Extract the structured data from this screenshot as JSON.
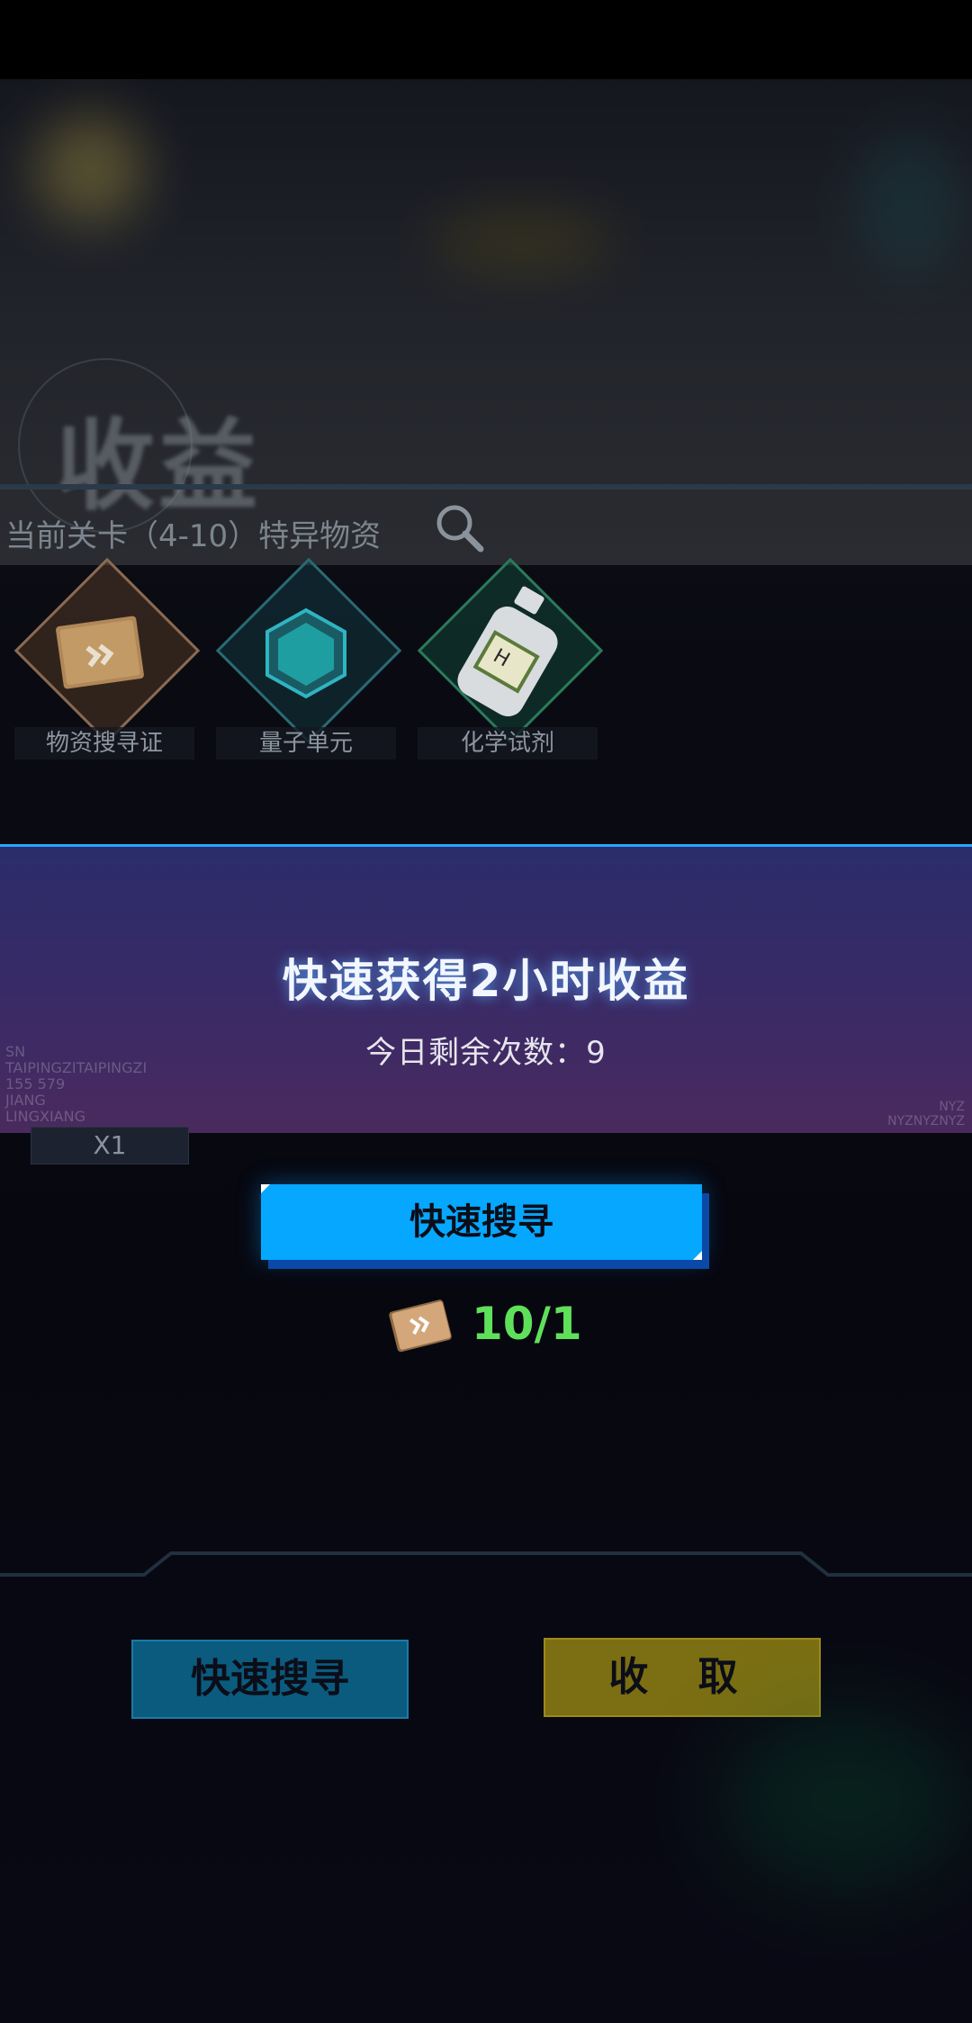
{
  "screen": {
    "title": "收益",
    "section_label": "当前关卡（4-10）特异物资"
  },
  "items": [
    {
      "label": "物资搜寻证",
      "icon": "search-permit-icon"
    },
    {
      "label": "量子单元",
      "icon": "quantum-unit-icon"
    },
    {
      "label": "化学试剂",
      "icon": "chemical-reagent-icon"
    }
  ],
  "modal": {
    "title": "快速获得2小时收益",
    "remaining": "今日剩余次数：9",
    "button_label": "快速搜寻",
    "cost_text": "10/1"
  },
  "background": {
    "faint_left": "SN\nTAIPINGZITAIPINGZI\n155 579\nJIANG\nLINGXIANG",
    "faint_right": "NYZ\nNYZNYZNYZ",
    "x1_label": "X1"
  },
  "bottom": {
    "quick_label": "快速搜寻",
    "collect_label": "收 取"
  },
  "colors": {
    "accent_blue": "#06a7ff",
    "cost_green": "#5fe05a",
    "collect_yellow": "#7c6e12"
  }
}
